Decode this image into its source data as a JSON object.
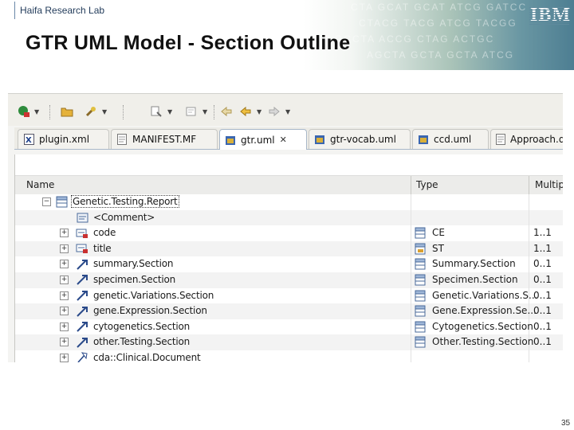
{
  "header": {
    "lab_name": "Haifa Research Lab",
    "title": "GTR UML Model - Section Outline",
    "logo_text": "IBM",
    "dna_text": [
      "CTA GCAT GCAT ATCG GATCC",
      "CTACG TACG ATCG TACGG",
      "GCCTA ACCG CTAG ACTGC",
      "AGCTA GCTA GCTA ATCG"
    ]
  },
  "tabs": [
    {
      "label": "plugin.xml",
      "icon": "xml-file-icon",
      "active": false
    },
    {
      "label": "MANIFEST.MF",
      "icon": "manifest-file-icon",
      "active": false
    },
    {
      "label": "gtr.uml",
      "icon": "uml-model-icon",
      "active": true,
      "close": "✕"
    },
    {
      "label": "gtr-vocab.uml",
      "icon": "uml-model-icon",
      "active": false
    },
    {
      "label": "ccd.uml",
      "icon": "uml-model-icon",
      "active": false
    },
    {
      "label": "Approach.dit",
      "icon": "document-file-icon",
      "active": false
    }
  ],
  "columns": {
    "name": "Name",
    "type": "Type",
    "multiplicity": "Multipl"
  },
  "rows": [
    {
      "expander": "−",
      "level": 0,
      "icon": "class-icon",
      "name": "Genetic.Testing.Report",
      "type": "",
      "mult": "",
      "selected": true
    },
    {
      "expander": "",
      "level": 1,
      "icon": "comment-icon",
      "name": "<Comment>",
      "type": "",
      "mult": ""
    },
    {
      "expander": "+",
      "level": 1,
      "icon": "attribute-icon",
      "name": "code",
      "type": "CE",
      "type_icon": "datatype-icon",
      "mult": "1..1"
    },
    {
      "expander": "+",
      "level": 1,
      "icon": "attribute-icon",
      "name": "title",
      "type": "ST",
      "type_icon": "datatype-icon",
      "mult": "1..1"
    },
    {
      "expander": "+",
      "level": 1,
      "icon": "association-icon",
      "name": "summary.Section",
      "type": "Summary.Section",
      "type_icon": "class-icon",
      "mult": "0..1"
    },
    {
      "expander": "+",
      "level": 1,
      "icon": "association-icon",
      "name": "specimen.Section",
      "type": "Specimen.Section",
      "type_icon": "class-icon",
      "mult": "0..1"
    },
    {
      "expander": "+",
      "level": 1,
      "icon": "association-icon",
      "name": "genetic.Variations.Section",
      "type": "Genetic.Variations.S...",
      "type_icon": "class-icon",
      "mult": "0..1"
    },
    {
      "expander": "+",
      "level": 1,
      "icon": "association-icon",
      "name": "gene.Expression.Section",
      "type": "Gene.Expression.Se...",
      "type_icon": "class-icon",
      "mult": "0..1"
    },
    {
      "expander": "+",
      "level": 1,
      "icon": "association-icon",
      "name": "cytogenetics.Section",
      "type": "Cytogenetics.Section",
      "type_icon": "class-icon",
      "mult": "0..1"
    },
    {
      "expander": "+",
      "level": 1,
      "icon": "association-icon",
      "name": "other.Testing.Section",
      "type": "Other.Testing.Section",
      "type_icon": "class-icon",
      "mult": "0..1"
    },
    {
      "expander": "+",
      "level": 1,
      "icon": "generalization-icon",
      "name": "cda::Clinical.Document",
      "type": "",
      "mult": ""
    }
  ],
  "page_number": "35"
}
